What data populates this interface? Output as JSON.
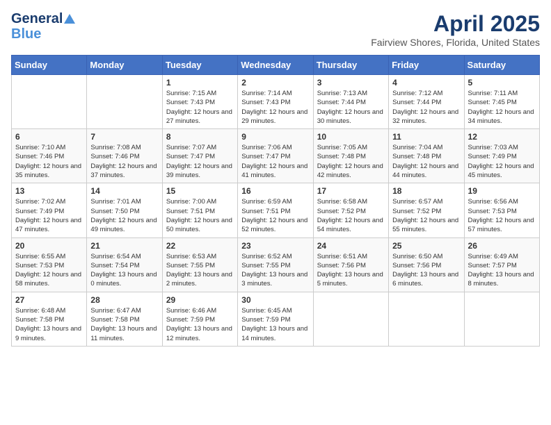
{
  "header": {
    "logo_line1": "General",
    "logo_line2": "Blue",
    "month_title": "April 2025",
    "location": "Fairview Shores, Florida, United States"
  },
  "days_of_week": [
    "Sunday",
    "Monday",
    "Tuesday",
    "Wednesday",
    "Thursday",
    "Friday",
    "Saturday"
  ],
  "weeks": [
    [
      {
        "day": "",
        "info": ""
      },
      {
        "day": "",
        "info": ""
      },
      {
        "day": "1",
        "info": "Sunrise: 7:15 AM\nSunset: 7:43 PM\nDaylight: 12 hours and 27 minutes."
      },
      {
        "day": "2",
        "info": "Sunrise: 7:14 AM\nSunset: 7:43 PM\nDaylight: 12 hours and 29 minutes."
      },
      {
        "day": "3",
        "info": "Sunrise: 7:13 AM\nSunset: 7:44 PM\nDaylight: 12 hours and 30 minutes."
      },
      {
        "day": "4",
        "info": "Sunrise: 7:12 AM\nSunset: 7:44 PM\nDaylight: 12 hours and 32 minutes."
      },
      {
        "day": "5",
        "info": "Sunrise: 7:11 AM\nSunset: 7:45 PM\nDaylight: 12 hours and 34 minutes."
      }
    ],
    [
      {
        "day": "6",
        "info": "Sunrise: 7:10 AM\nSunset: 7:46 PM\nDaylight: 12 hours and 35 minutes."
      },
      {
        "day": "7",
        "info": "Sunrise: 7:08 AM\nSunset: 7:46 PM\nDaylight: 12 hours and 37 minutes."
      },
      {
        "day": "8",
        "info": "Sunrise: 7:07 AM\nSunset: 7:47 PM\nDaylight: 12 hours and 39 minutes."
      },
      {
        "day": "9",
        "info": "Sunrise: 7:06 AM\nSunset: 7:47 PM\nDaylight: 12 hours and 41 minutes."
      },
      {
        "day": "10",
        "info": "Sunrise: 7:05 AM\nSunset: 7:48 PM\nDaylight: 12 hours and 42 minutes."
      },
      {
        "day": "11",
        "info": "Sunrise: 7:04 AM\nSunset: 7:48 PM\nDaylight: 12 hours and 44 minutes."
      },
      {
        "day": "12",
        "info": "Sunrise: 7:03 AM\nSunset: 7:49 PM\nDaylight: 12 hours and 45 minutes."
      }
    ],
    [
      {
        "day": "13",
        "info": "Sunrise: 7:02 AM\nSunset: 7:49 PM\nDaylight: 12 hours and 47 minutes."
      },
      {
        "day": "14",
        "info": "Sunrise: 7:01 AM\nSunset: 7:50 PM\nDaylight: 12 hours and 49 minutes."
      },
      {
        "day": "15",
        "info": "Sunrise: 7:00 AM\nSunset: 7:51 PM\nDaylight: 12 hours and 50 minutes."
      },
      {
        "day": "16",
        "info": "Sunrise: 6:59 AM\nSunset: 7:51 PM\nDaylight: 12 hours and 52 minutes."
      },
      {
        "day": "17",
        "info": "Sunrise: 6:58 AM\nSunset: 7:52 PM\nDaylight: 12 hours and 54 minutes."
      },
      {
        "day": "18",
        "info": "Sunrise: 6:57 AM\nSunset: 7:52 PM\nDaylight: 12 hours and 55 minutes."
      },
      {
        "day": "19",
        "info": "Sunrise: 6:56 AM\nSunset: 7:53 PM\nDaylight: 12 hours and 57 minutes."
      }
    ],
    [
      {
        "day": "20",
        "info": "Sunrise: 6:55 AM\nSunset: 7:53 PM\nDaylight: 12 hours and 58 minutes."
      },
      {
        "day": "21",
        "info": "Sunrise: 6:54 AM\nSunset: 7:54 PM\nDaylight: 13 hours and 0 minutes."
      },
      {
        "day": "22",
        "info": "Sunrise: 6:53 AM\nSunset: 7:55 PM\nDaylight: 13 hours and 2 minutes."
      },
      {
        "day": "23",
        "info": "Sunrise: 6:52 AM\nSunset: 7:55 PM\nDaylight: 13 hours and 3 minutes."
      },
      {
        "day": "24",
        "info": "Sunrise: 6:51 AM\nSunset: 7:56 PM\nDaylight: 13 hours and 5 minutes."
      },
      {
        "day": "25",
        "info": "Sunrise: 6:50 AM\nSunset: 7:56 PM\nDaylight: 13 hours and 6 minutes."
      },
      {
        "day": "26",
        "info": "Sunrise: 6:49 AM\nSunset: 7:57 PM\nDaylight: 13 hours and 8 minutes."
      }
    ],
    [
      {
        "day": "27",
        "info": "Sunrise: 6:48 AM\nSunset: 7:58 PM\nDaylight: 13 hours and 9 minutes."
      },
      {
        "day": "28",
        "info": "Sunrise: 6:47 AM\nSunset: 7:58 PM\nDaylight: 13 hours and 11 minutes."
      },
      {
        "day": "29",
        "info": "Sunrise: 6:46 AM\nSunset: 7:59 PM\nDaylight: 13 hours and 12 minutes."
      },
      {
        "day": "30",
        "info": "Sunrise: 6:45 AM\nSunset: 7:59 PM\nDaylight: 13 hours and 14 minutes."
      },
      {
        "day": "",
        "info": ""
      },
      {
        "day": "",
        "info": ""
      },
      {
        "day": "",
        "info": ""
      }
    ]
  ]
}
